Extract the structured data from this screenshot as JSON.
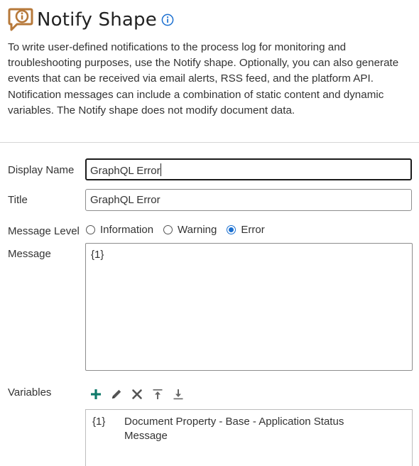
{
  "header": {
    "title": "Notify Shape",
    "logo_icon": "notify-speech-bubble-icon",
    "info_icon": "info-icon",
    "brand_color": "#b7793a"
  },
  "description": "To write user-defined notifications to the process log for monitoring and troubleshooting purposes, use the Notify shape. Optionally, you can also generate events that can be received via email alerts, RSS feed, and the platform API. Notification messages can include a combination of static content and dynamic variables. The Notify shape does not modify document data.",
  "form": {
    "display_name": {
      "label": "Display Name",
      "value": "GraphQL Error"
    },
    "title": {
      "label": "Title",
      "value": "GraphQL Error"
    },
    "message_level": {
      "label": "Message Level",
      "options": [
        "Information",
        "Warning",
        "Error"
      ],
      "selected": "Error"
    },
    "message": {
      "label": "Message",
      "value": "{1}"
    },
    "variables": {
      "label": "Variables",
      "toolbar": [
        "add-icon",
        "edit-pencil-icon",
        "delete-x-icon",
        "move-to-top-icon",
        "move-to-bottom-icon"
      ],
      "rows": [
        {
          "key": "{1}",
          "value": "Document Property - Base - Application Status Message"
        }
      ]
    }
  },
  "colors": {
    "accent": "#1a6fd0",
    "add_icon": "#0f7a6b",
    "text": "#333333"
  }
}
